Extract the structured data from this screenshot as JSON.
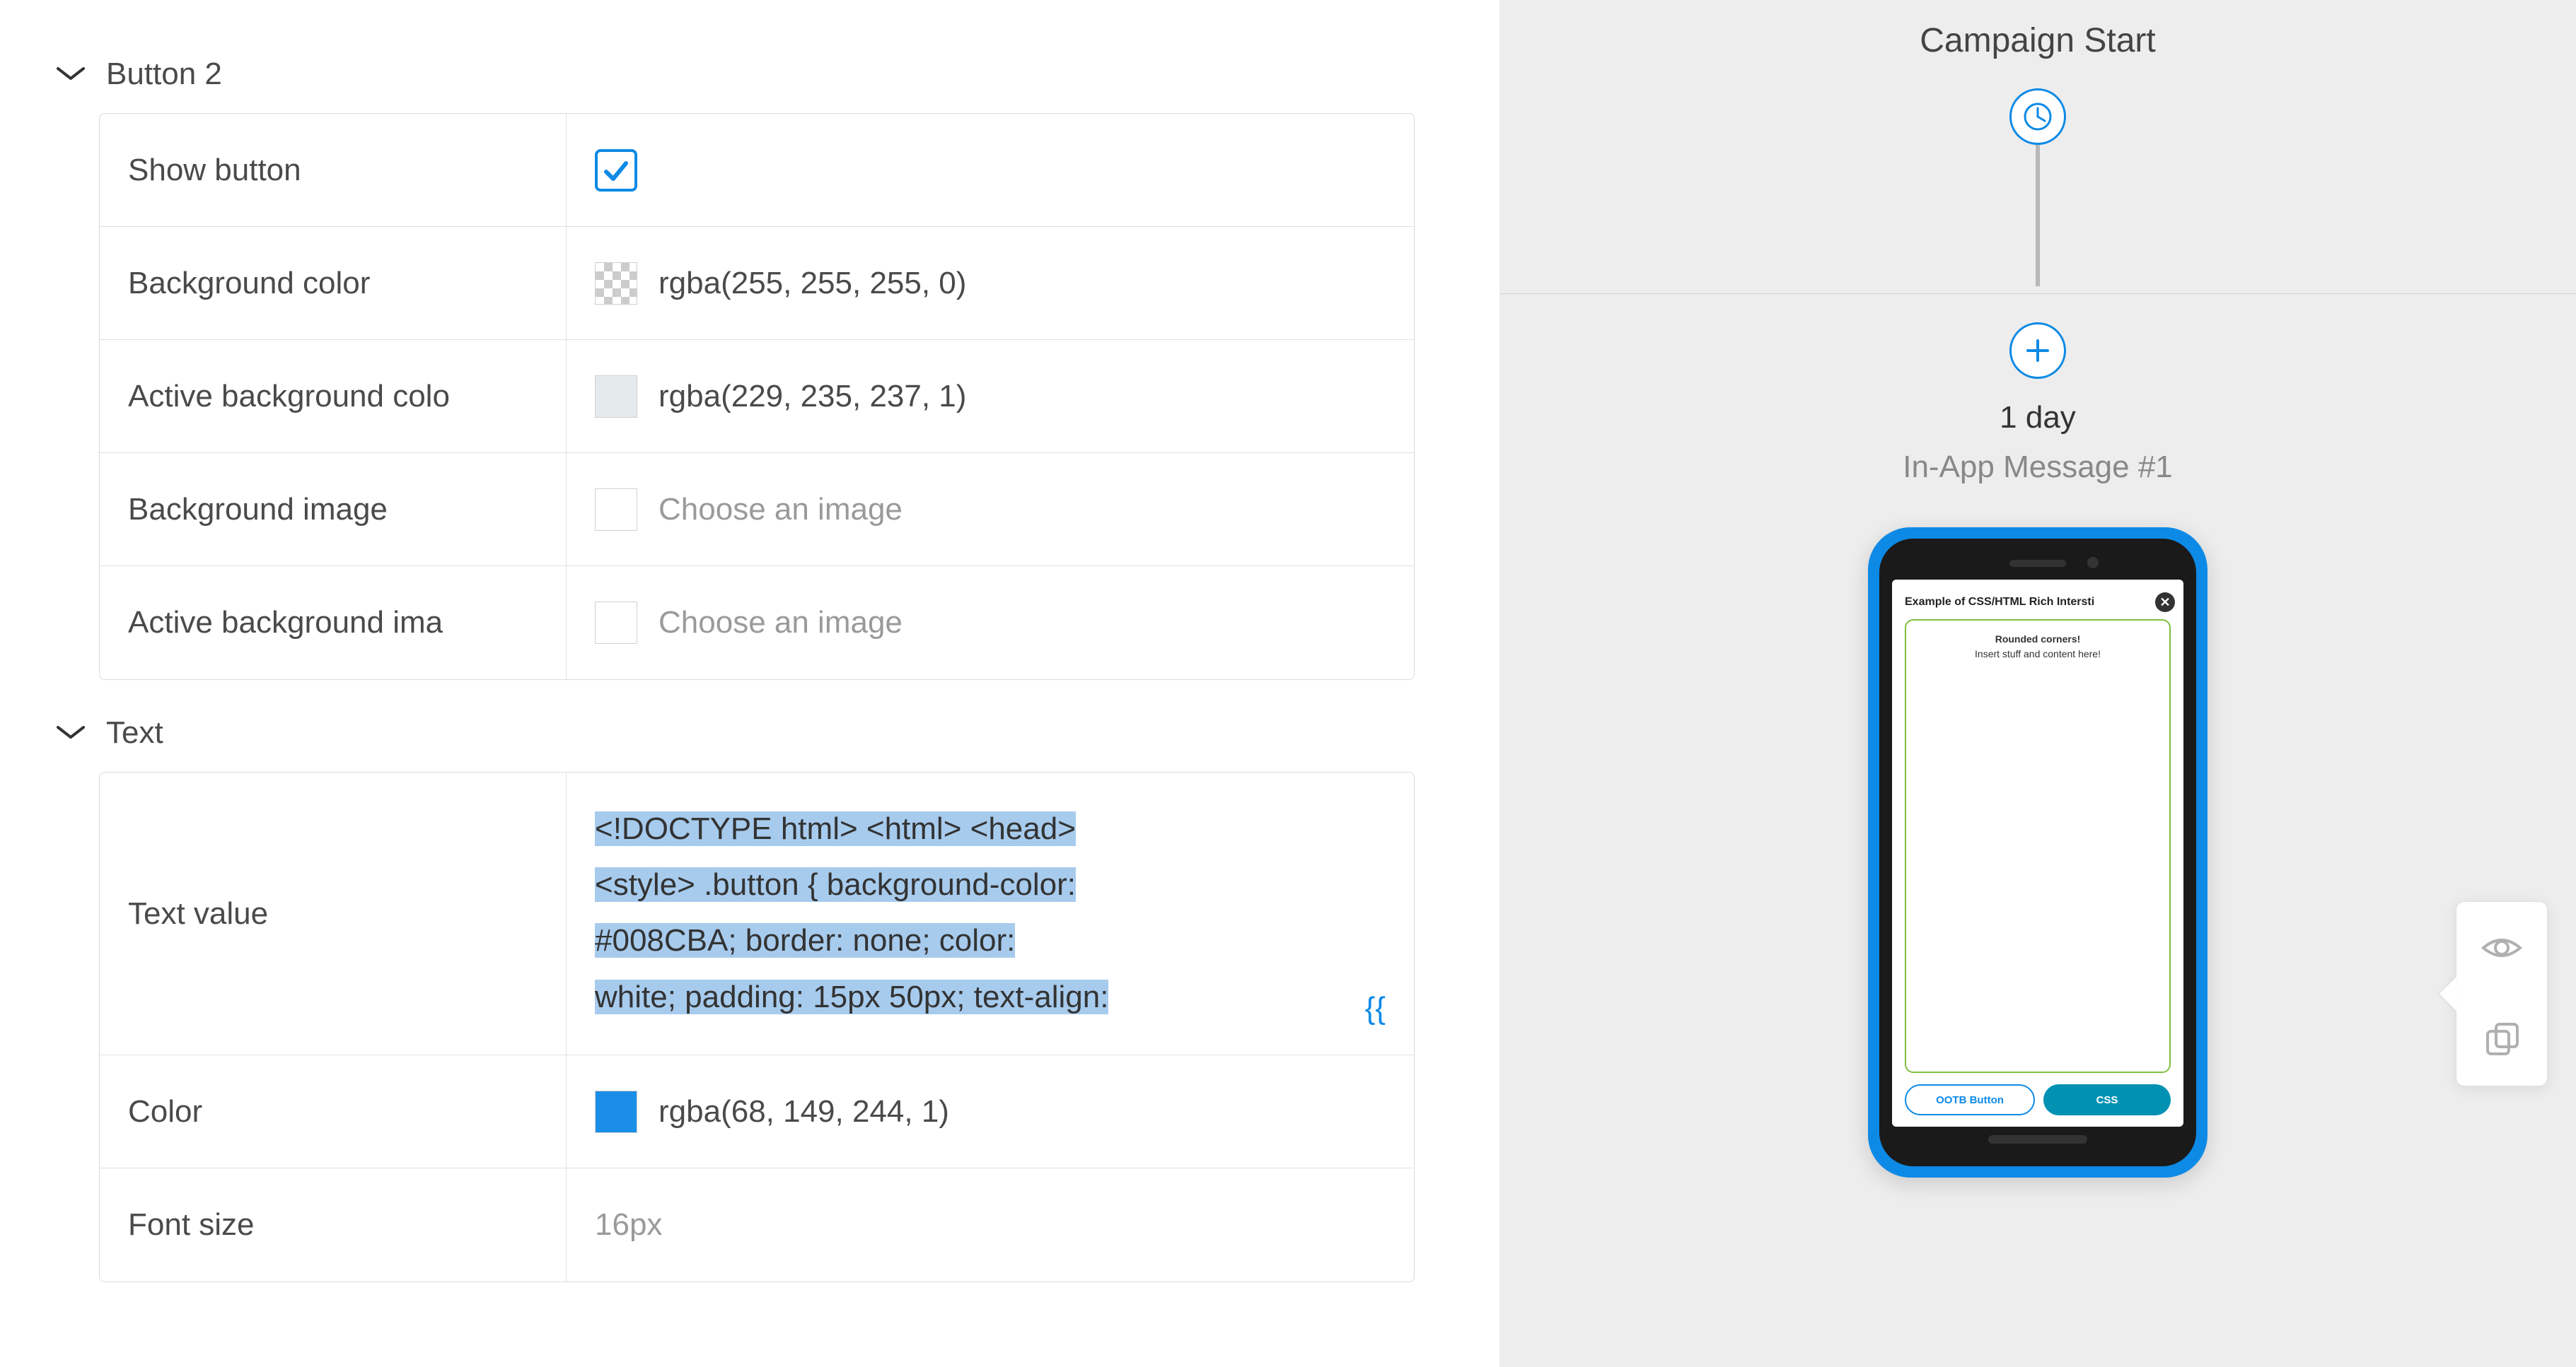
{
  "sections": {
    "button2": {
      "title": "Button 2",
      "rows": {
        "show_label": "Show button",
        "bgcolor_label": "Background color",
        "bgcolor_value": "rgba(255, 255, 255, 0)",
        "active_bgcolor_label": "Active background colo",
        "active_bgcolor_value": "rgba(229, 235, 237, 1)",
        "active_bgcolor_swatch": "#e5ebed",
        "bgimage_label": "Background image",
        "bgimage_placeholder": "Choose an image",
        "active_bgimage_label": "Active background ima",
        "active_bgimage_placeholder": "Choose an image"
      }
    },
    "text": {
      "title": "Text",
      "rows": {
        "textvalue_label": "Text value",
        "textvalue_content_l1": "<!DOCTYPE html> <html> <head>",
        "textvalue_content_l2": "<style> .button {   background-color:",
        "textvalue_content_l3": "#008CBA;   border: none;   color:",
        "textvalue_content_l4": "white;   padding: 15px 50px;   text-align:",
        "merge_token": "{{",
        "color_label": "Color",
        "color_value": "rgba(68, 149, 244, 1)",
        "color_swatch": "#1b8fe8",
        "fontsize_label": "Font size",
        "fontsize_value": "16px"
      }
    }
  },
  "campaign": {
    "title": "Campaign Start",
    "day_label": "1 day",
    "message_label": "In-App Message #1"
  },
  "phone_preview": {
    "modal_title": "Example of CSS/HTML Rich Intersti",
    "body_line1": "Rounded corners!",
    "body_line2": "Insert stuff and content here!",
    "btn_outline": "OOTB Button",
    "btn_fill": "CSS"
  }
}
